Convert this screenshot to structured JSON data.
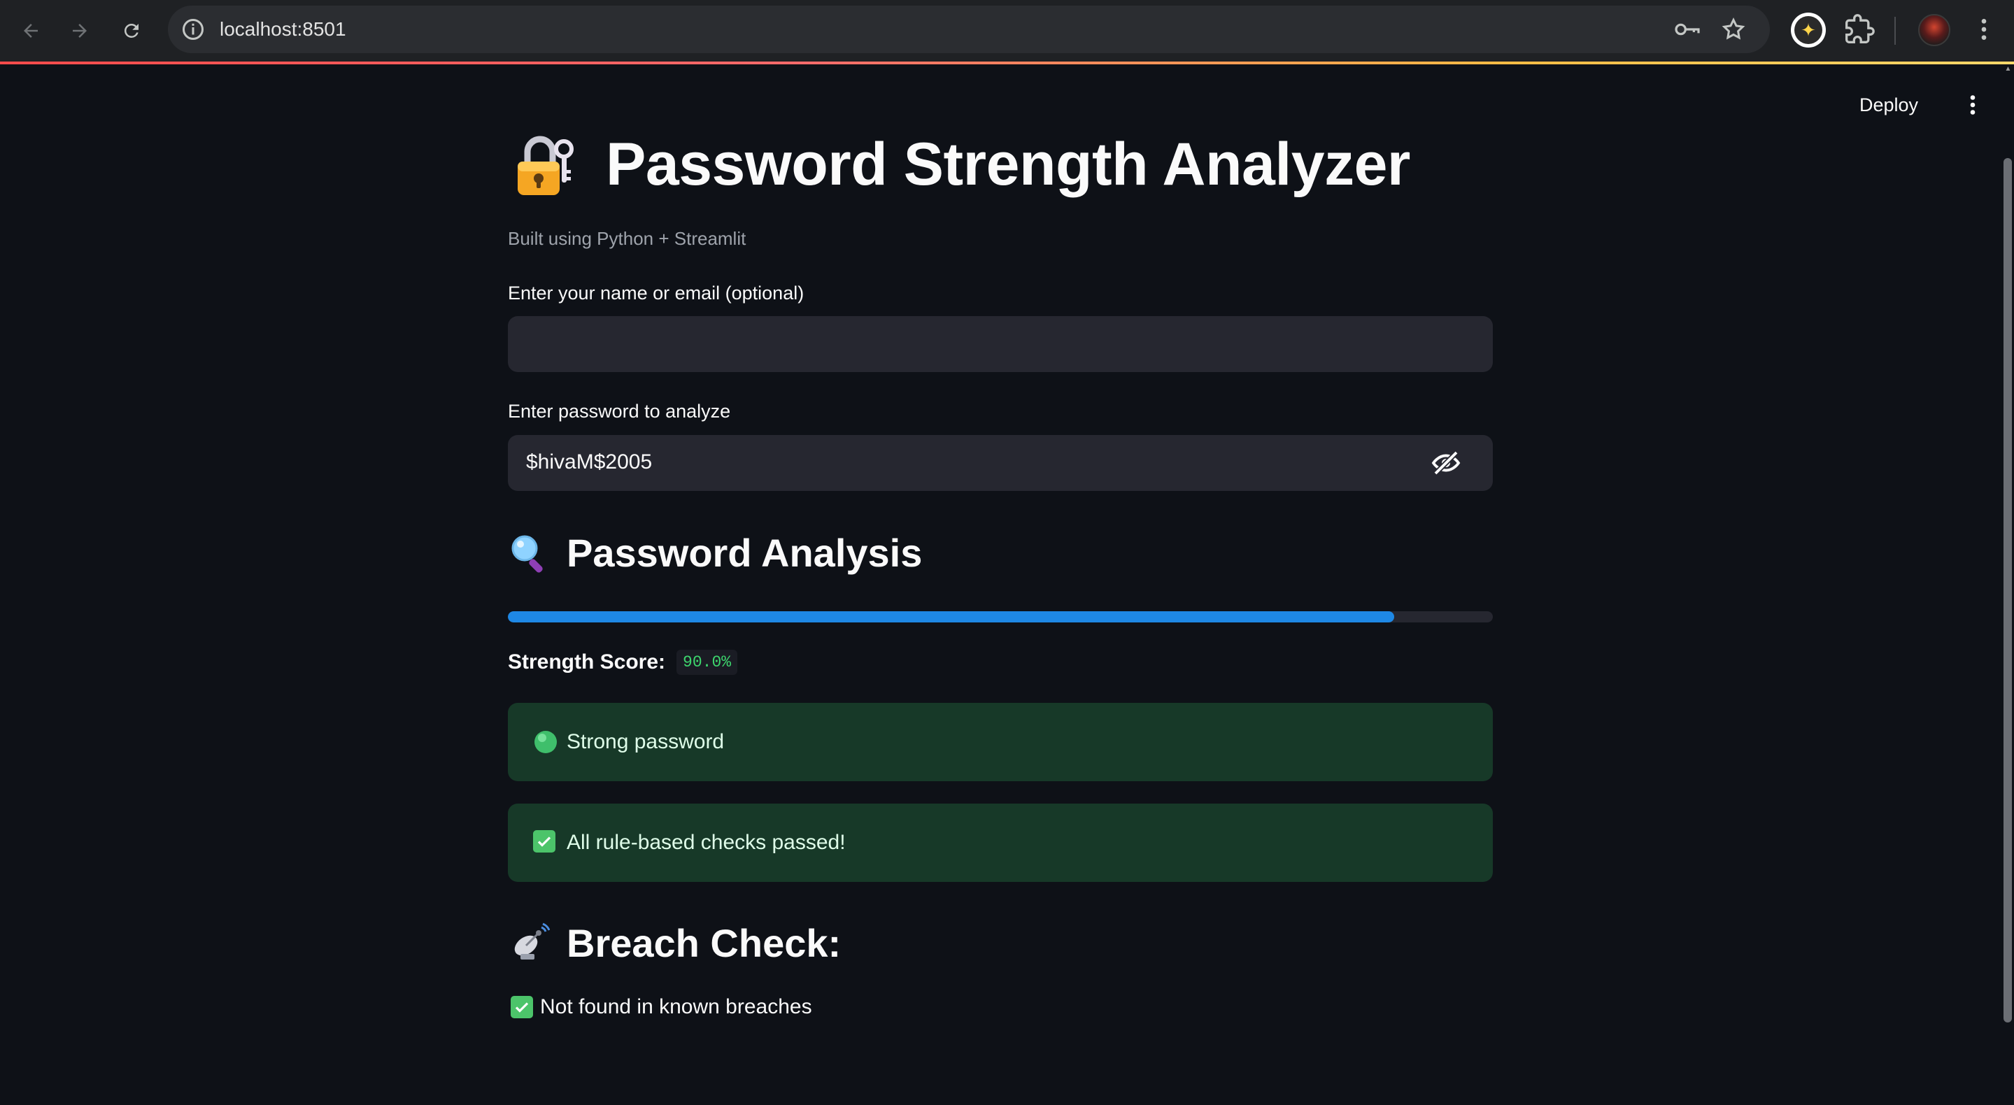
{
  "browser": {
    "url": "localhost:8501",
    "icons": [
      "back-arrow-icon",
      "forward-arrow-icon",
      "reload-icon",
      "site-info-icon",
      "password-key-icon",
      "bookmark-star-icon",
      "gemini-extension-icon",
      "extensions-puzzle-icon",
      "profile-avatar",
      "browser-menu-icon"
    ]
  },
  "app_header": {
    "deploy_label": "Deploy",
    "menu_icon": "vertical-dots-icon"
  },
  "page": {
    "title": "Password Strength Analyzer",
    "title_icon": "lock-with-key-icon",
    "caption": "Built using Python + Streamlit"
  },
  "form": {
    "name_label": "Enter your name or email (optional)",
    "name_value": "",
    "password_label": "Enter password to analyze",
    "password_value": "$hivaM$2005",
    "visibility_icon": "eye-slash-icon"
  },
  "analysis": {
    "heading": "Password Analysis",
    "heading_icon": "magnifying-glass-icon",
    "progress_fraction": 0.9,
    "score_label": "Strength Score:",
    "score_value": "90.0%",
    "strength_message": "Strong password",
    "strength_icon": "green-circle-icon",
    "rules_message": "All rule-based checks passed!",
    "rules_icon": "check-mark-button-icon"
  },
  "breach": {
    "heading": "Breach Check:",
    "heading_icon": "satellite-antenna-icon",
    "result": "Not found in known breaches",
    "result_icon": "check-mark-button-icon"
  },
  "colors": {
    "background": "#0e1117",
    "input_bg": "#262730",
    "progress": "#1e88e5",
    "success_bg": "#173928",
    "score_text": "#3dd56d"
  }
}
